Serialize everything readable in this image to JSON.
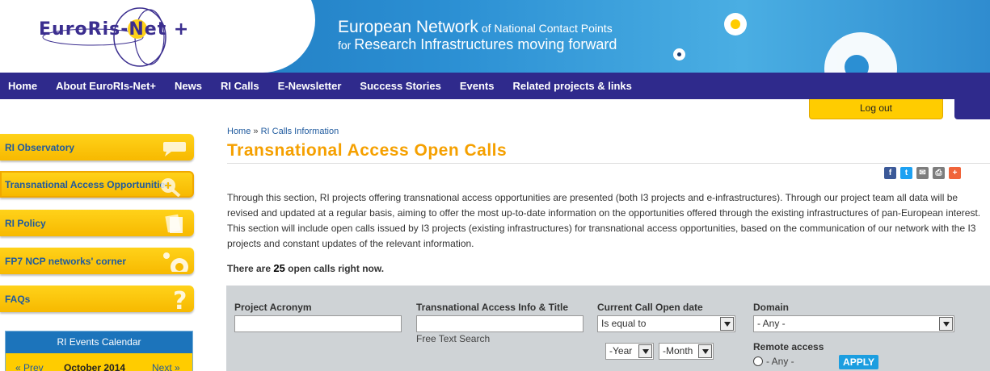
{
  "header": {
    "logo_text": "EuroRis-Net +",
    "tagline_line1_a": "European Network",
    "tagline_line1_b": " of National Contact Points",
    "tagline_line2_a": "for ",
    "tagline_line2_b": "Research Infrastructures moving forward"
  },
  "nav": {
    "items": [
      "Home",
      "About EuroRIs-Net+",
      "News",
      "RI Calls",
      "E-Newsletter",
      "Success Stories",
      "Events",
      "Related projects & links"
    ]
  },
  "account": {
    "logout_label": "Log out"
  },
  "sidebar": {
    "items": [
      {
        "label": "RI Observatory",
        "icon": "speech-bubbles-icon"
      },
      {
        "label": "Transnational Access Opportunities",
        "icon": "magnifier-plus-icon"
      },
      {
        "label": "RI Policy",
        "icon": "documents-icon"
      },
      {
        "label": "FP7 NCP networks' corner",
        "icon": "circle-icon"
      },
      {
        "label": "FAQs",
        "icon": "question-mark-icon"
      }
    ],
    "calendar": {
      "title": "RI Events Calendar",
      "prev": "« Prev",
      "month": "October 2014",
      "next": "Next »"
    }
  },
  "breadcrumb": {
    "home": "Home",
    "separator": "»",
    "current": "RI Calls Information"
  },
  "page": {
    "title": "Transnational Access Open Calls",
    "paragraph": "Through this section, RI projects offering transnational access opportunities are presented (both I3 projects and e-infrastructures). Through our project team all data will be revised and updated at a regular basis, aiming to offer the most up-to-date information on the opportunities offered through the existing infrastructures of pan-European interest. This section will include open calls issued by I3 projects (existing infrastructures) for transnational access opportunities, based on the communication of our network with the I3 projects and constant updates of the relevant information.",
    "count_prefix": "There are ",
    "count_value": "25",
    "count_suffix": " open calls right now."
  },
  "share": {
    "icons": [
      "facebook-icon",
      "twitter-icon",
      "email-icon",
      "print-icon",
      "plus-icon"
    ],
    "glyphs": [
      "f",
      "t",
      "✉",
      "⎙",
      "+"
    ],
    "colors": [
      "#3b5998",
      "#1da1f2",
      "#7d7d7d",
      "#7d7d7d",
      "#f0643a"
    ]
  },
  "filter": {
    "project_acronym_label": "Project Acronym",
    "project_acronym_value": "",
    "ta_info_label": "Transnational Access Info & Title",
    "ta_info_value": "",
    "ta_info_hint": "Free Text Search",
    "open_date_label": "Current Call Open date",
    "open_date_operator": "Is equal to",
    "year_value": "-Year",
    "month_value": "-Month",
    "domain_label": "Domain",
    "domain_value": "- Any -",
    "remote_label": "Remote access",
    "remote_option": "- Any -",
    "apply_label": "APPLY"
  }
}
